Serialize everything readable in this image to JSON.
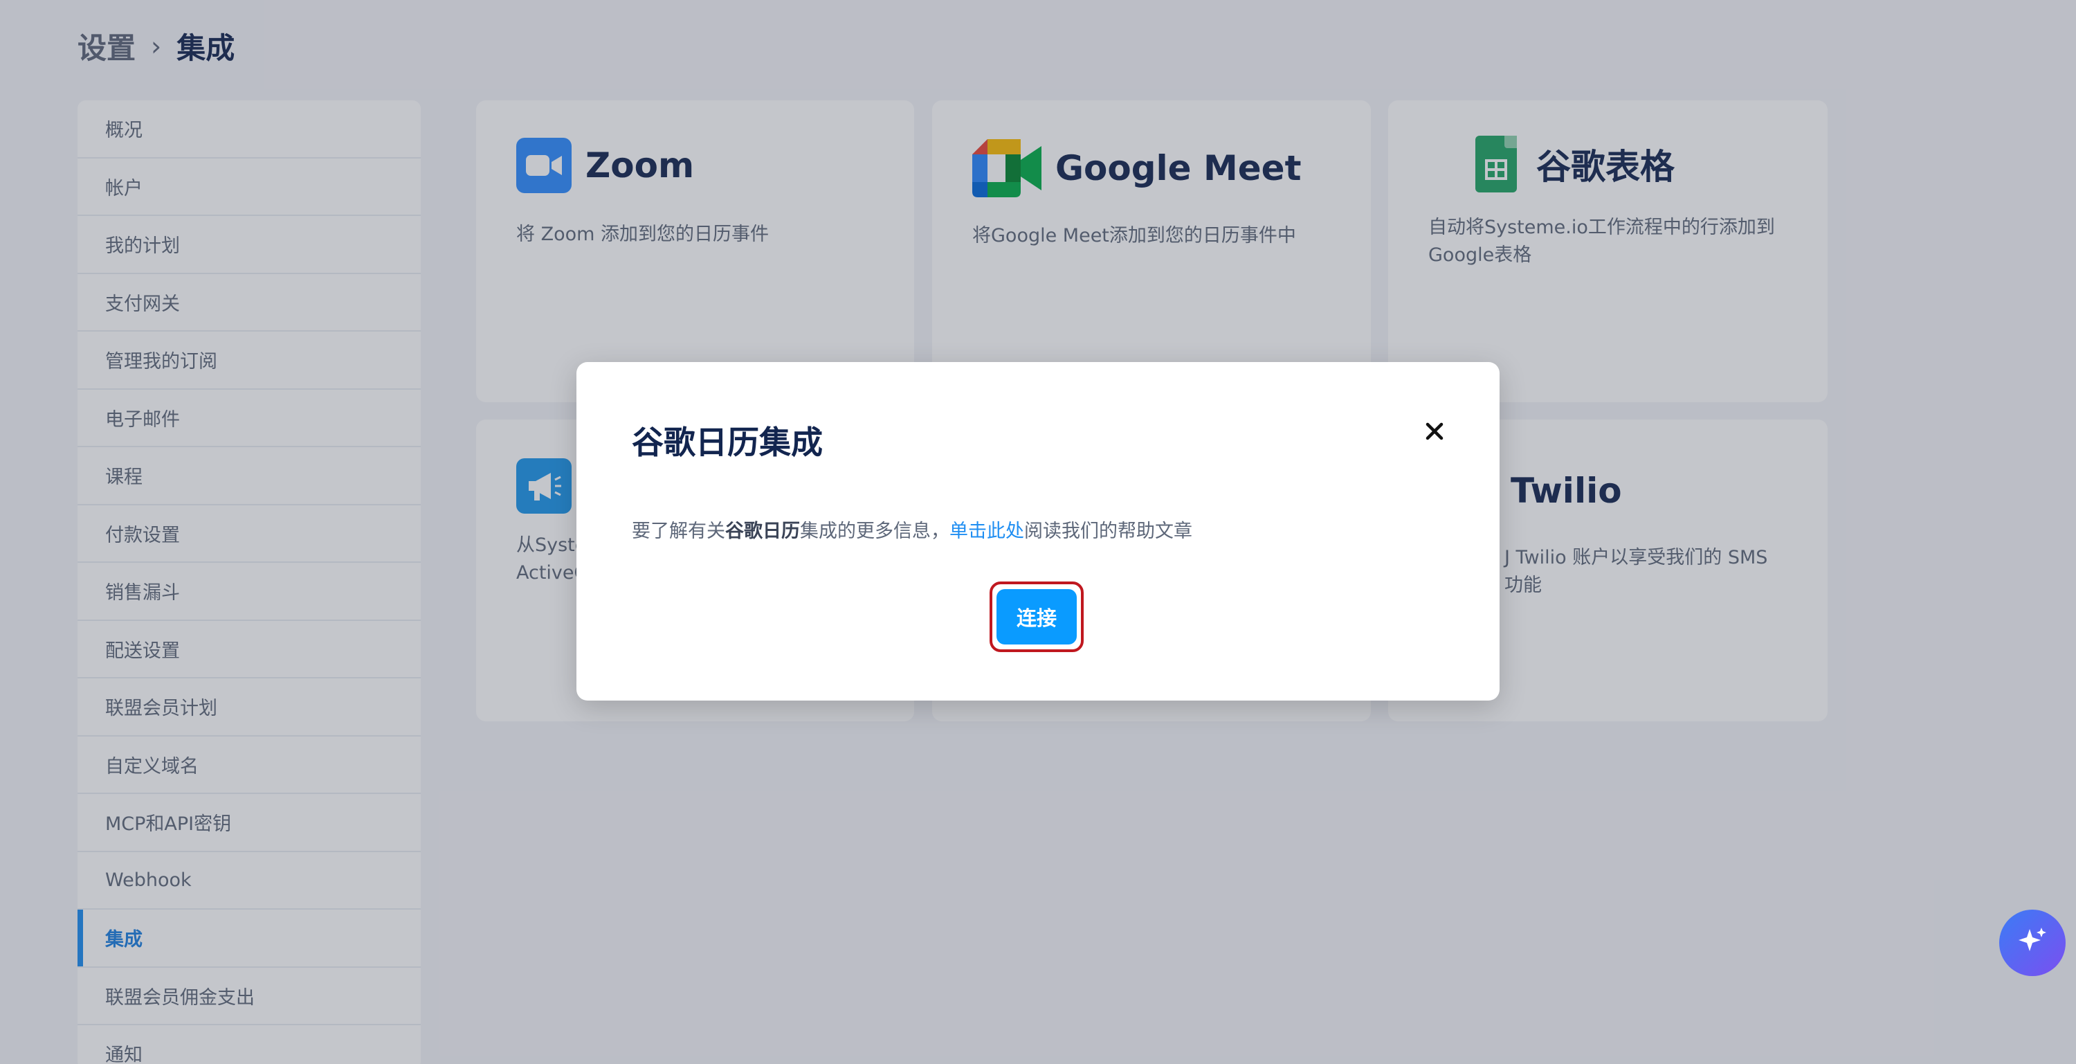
{
  "breadcrumb": {
    "parent": "设置",
    "separator": "›",
    "current": "集成"
  },
  "sidebar": {
    "items": [
      {
        "label": "概况"
      },
      {
        "label": "帐户"
      },
      {
        "label": "我的计划"
      },
      {
        "label": "支付网关"
      },
      {
        "label": "管理我的订阅"
      },
      {
        "label": "电子邮件"
      },
      {
        "label": "课程"
      },
      {
        "label": "付款设置"
      },
      {
        "label": "销售漏斗"
      },
      {
        "label": "配送设置"
      },
      {
        "label": "联盟会员计划"
      },
      {
        "label": "自定义域名"
      },
      {
        "label": "MCP和API密钥"
      },
      {
        "label": "Webhook"
      },
      {
        "label": "集成",
        "active": true
      },
      {
        "label": "联盟会员佣金支出"
      },
      {
        "label": "通知"
      }
    ]
  },
  "cards": {
    "zoom": {
      "title": "Zoom",
      "desc": "将 Zoom 添加到您的日历事件"
    },
    "meet": {
      "title": "Google Meet",
      "desc": "将Google Meet添加到您的日历事件中"
    },
    "sheets": {
      "title": "谷歌表格",
      "desc": "自动将Systeme.io工作流程中的行添加到Google表格"
    },
    "activecampaign": {
      "desc_line1": "从Syste",
      "desc_line2": "ActiveC"
    },
    "twilio": {
      "title": "Twilio",
      "desc_line1": "J Twilio 账户以享受我们的 SMS",
      "desc_line2": "功能"
    }
  },
  "modal": {
    "title": "谷歌日历集成",
    "text_prefix": "要了解有关",
    "text_bold": "谷歌日历",
    "text_mid": "集成的更多信息，",
    "link": "单击此处",
    "text_suffix": "阅读我们的帮助文章",
    "connect_label": "连接"
  },
  "icons": {
    "close": "close-icon",
    "zoom": "video-camera-icon",
    "meet": "google-meet-icon",
    "sheets": "spreadsheet-icon",
    "activecampaign": "megaphone-icon",
    "fab": "sparkles-icon"
  },
  "colors": {
    "primary": "#0a9bff",
    "link": "#1f8ef2",
    "highlight_border": "#c0181f",
    "sidebar_active": "#1b7fe0"
  }
}
